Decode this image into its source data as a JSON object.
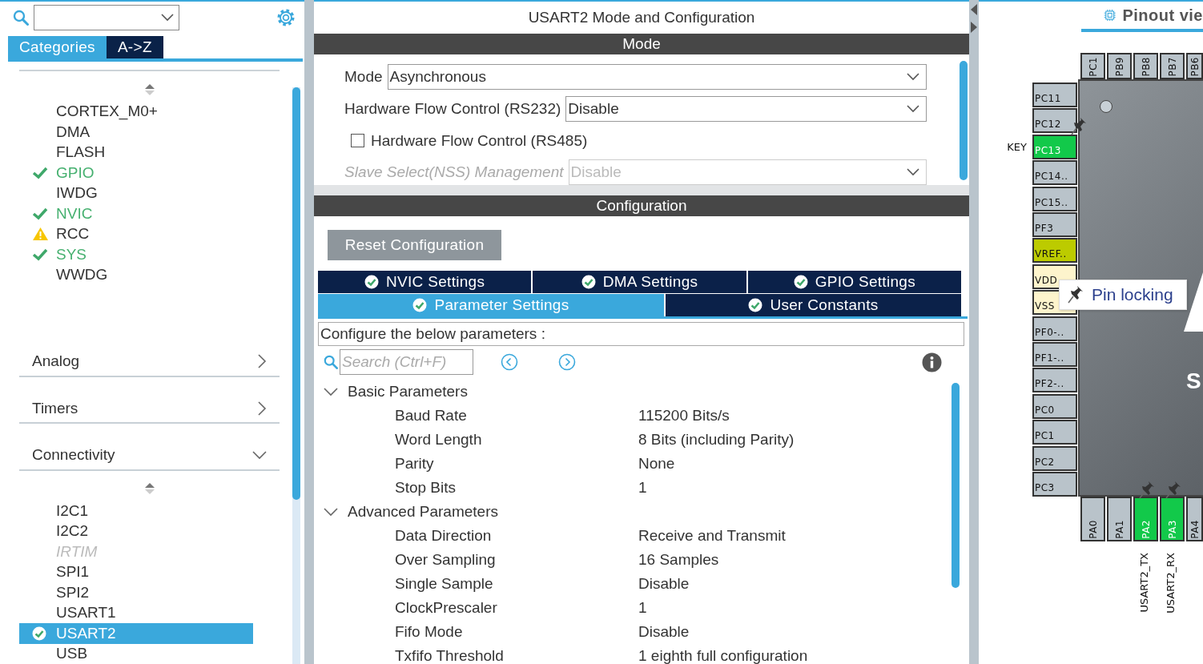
{
  "sidebar": {
    "tabs": [
      {
        "label": "Categories",
        "selected": true
      },
      {
        "label": "A->Z",
        "selected": false
      }
    ],
    "system_core": [
      {
        "label": "CORTEX_M0+",
        "configured": false,
        "warning": false,
        "disabled": false
      },
      {
        "label": "DMA",
        "configured": false,
        "warning": false,
        "disabled": false
      },
      {
        "label": "FLASH",
        "configured": false,
        "warning": false,
        "disabled": false
      },
      {
        "label": "GPIO",
        "configured": true,
        "warning": false,
        "disabled": false
      },
      {
        "label": "IWDG",
        "configured": false,
        "warning": false,
        "disabled": false
      },
      {
        "label": "NVIC",
        "configured": true,
        "warning": false,
        "disabled": false
      },
      {
        "label": "RCC",
        "configured": false,
        "warning": true,
        "disabled": false
      },
      {
        "label": "SYS",
        "configured": true,
        "warning": false,
        "disabled": false
      },
      {
        "label": "WWDG",
        "configured": false,
        "warning": false,
        "disabled": false
      }
    ],
    "categories": [
      {
        "label": "Analog",
        "expanded": false
      },
      {
        "label": "Timers",
        "expanded": false
      },
      {
        "label": "Connectivity",
        "expanded": true,
        "children": [
          {
            "label": "I2C1",
            "configured": false,
            "warning": false,
            "disabled": false,
            "selected": false
          },
          {
            "label": "I2C2",
            "configured": false,
            "warning": false,
            "disabled": false,
            "selected": false
          },
          {
            "label": "IRTIM",
            "configured": false,
            "warning": false,
            "disabled": true,
            "selected": false
          },
          {
            "label": "SPI1",
            "configured": false,
            "warning": false,
            "disabled": false,
            "selected": false
          },
          {
            "label": "SPI2",
            "configured": false,
            "warning": false,
            "disabled": false,
            "selected": false
          },
          {
            "label": "USART1",
            "configured": false,
            "warning": false,
            "disabled": false,
            "selected": false
          },
          {
            "label": "USART2",
            "configured": true,
            "warning": false,
            "disabled": false,
            "selected": true
          },
          {
            "label": "USB",
            "configured": false,
            "warning": false,
            "disabled": false,
            "selected": false
          }
        ]
      }
    ]
  },
  "config": {
    "title": "USART2 Mode and Configuration",
    "mode_header": "Mode",
    "mode_fields": [
      {
        "kind": "dropdown",
        "label": "Mode",
        "value": "Asynchronous",
        "disabled": false
      },
      {
        "kind": "dropdown",
        "label": "Hardware Flow Control (RS232)",
        "value": "Disable",
        "disabled": false
      },
      {
        "kind": "checkbox",
        "label": "Hardware Flow Control (RS485)",
        "checked": false
      },
      {
        "kind": "dropdown",
        "label": "Slave Select(NSS) Management",
        "value": "Disable",
        "disabled": true
      }
    ],
    "configuration_header": "Configuration",
    "reset_button": "Reset Configuration",
    "tab_rows": [
      [
        {
          "label": "NVIC Settings",
          "selected": false
        },
        {
          "label": "DMA Settings",
          "selected": false
        },
        {
          "label": "GPIO Settings",
          "selected": false
        }
      ],
      [
        {
          "label": "Parameter Settings",
          "selected": true
        },
        {
          "label": "User Constants",
          "selected": false
        }
      ]
    ],
    "hint": "Configure the below parameters :",
    "search": {
      "placeholder": "Search (Ctrl+F)"
    },
    "parameter_groups": [
      {
        "label": "Basic Parameters",
        "expanded": true,
        "children": [
          {
            "name": "Baud Rate",
            "value": "115200 Bits/s"
          },
          {
            "name": "Word Length",
            "value": "8 Bits (including Parity)"
          },
          {
            "name": "Parity",
            "value": "None"
          },
          {
            "name": "Stop Bits",
            "value": "1"
          }
        ]
      },
      {
        "label": "Advanced Parameters",
        "expanded": true,
        "children": [
          {
            "name": "Data Direction",
            "value": "Receive and Transmit"
          },
          {
            "name": "Over Sampling",
            "value": "16 Samples"
          },
          {
            "name": "Single Sample",
            "value": "Disable"
          },
          {
            "name": "ClockPrescaler",
            "value": "1"
          },
          {
            "name": "Fifo Mode",
            "value": "Disable"
          },
          {
            "name": "Txfifo Threshold",
            "value": "1 eighth full configuration"
          }
        ]
      }
    ]
  },
  "pinout": {
    "title": "Pinout vie",
    "chip_letter": "S",
    "tooltip": "Pin locking",
    "top_pins": [
      {
        "name": "PC1",
        "color": "#b9c3ca"
      },
      {
        "name": "PB9",
        "color": "#b9c3ca"
      },
      {
        "name": "PB8",
        "color": "#b9c3ca"
      },
      {
        "name": "PB7",
        "color": "#b9c3ca"
      },
      {
        "name": "PB6",
        "color": "#b9c3ca"
      }
    ],
    "left_pins": [
      {
        "name": "PC11",
        "color": "#b9c3ca",
        "locked": false
      },
      {
        "name": "PC12",
        "color": "#b9c3ca",
        "locked": false
      },
      {
        "name": "PC13",
        "color": "#12c94a",
        "label": "KEY",
        "locked": true
      },
      {
        "name": "PC14..",
        "color": "#b9c3ca",
        "locked": false
      },
      {
        "name": "PC15..",
        "color": "#b9c3ca",
        "locked": false
      },
      {
        "name": "PF3",
        "color": "#b9c3ca",
        "locked": false
      },
      {
        "name": "VREF..",
        "color": "#bccb00",
        "locked": false
      },
      {
        "name": "VDD",
        "color": "#fdf4cc",
        "locked": false
      },
      {
        "name": "VSS",
        "color": "#fdf4cc",
        "locked": false
      },
      {
        "name": "PF0-..",
        "color": "#b9c3ca",
        "locked": false
      },
      {
        "name": "PF1-..",
        "color": "#b9c3ca",
        "locked": false
      },
      {
        "name": "PF2-..",
        "color": "#b9c3ca",
        "locked": false
      },
      {
        "name": "PC0",
        "color": "#b9c3ca",
        "locked": false
      },
      {
        "name": "PC1",
        "color": "#b9c3ca",
        "locked": false
      },
      {
        "name": "PC2",
        "color": "#b9c3ca",
        "locked": false
      },
      {
        "name": "PC3",
        "color": "#b9c3ca",
        "locked": false
      }
    ],
    "bottom_pins": [
      {
        "name": "PA0",
        "color": "#b9c3ca",
        "locked": false
      },
      {
        "name": "PA1",
        "color": "#b9c3ca",
        "locked": false
      },
      {
        "name": "PA2",
        "color": "#12c94a",
        "label": "USART2_TX",
        "locked": true
      },
      {
        "name": "PA3",
        "color": "#12c94a",
        "label": "USART2_RX",
        "locked": true
      },
      {
        "name": "PA4",
        "color": "#b9c3ca",
        "locked": false
      }
    ]
  }
}
